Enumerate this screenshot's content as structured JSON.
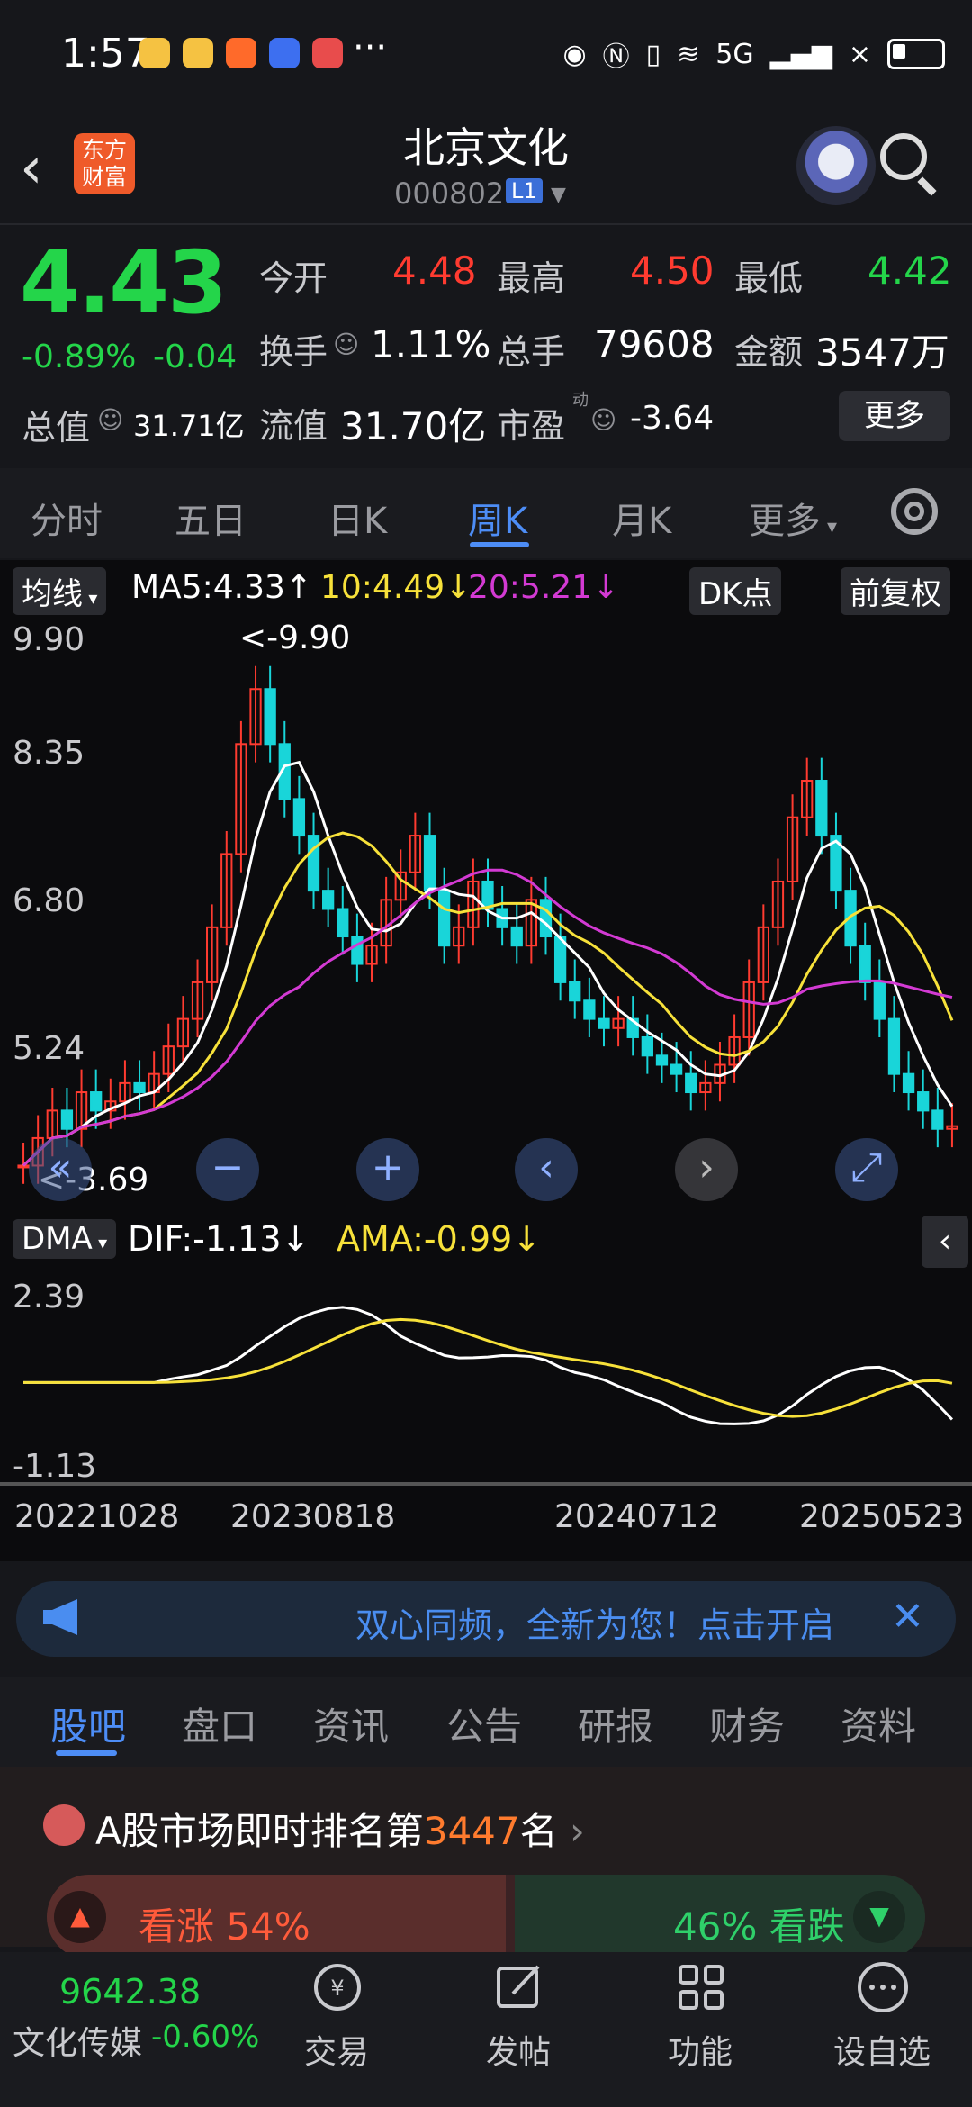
{
  "status": {
    "time": "1:57",
    "more": "···",
    "network": "5G",
    "x": "×"
  },
  "header": {
    "name": "北京文化",
    "code": "000802",
    "badge": "L1",
    "logo_text": "东方\n财富"
  },
  "quote": {
    "price": "4.43",
    "change_pct": "-0.89%",
    "change": "-0.04",
    "fields": [
      {
        "label": "今开",
        "value": "4.48",
        "color": "red"
      },
      {
        "label": "最高",
        "value": "4.50",
        "color": "red"
      },
      {
        "label": "最低",
        "value": "4.42",
        "color": "green"
      },
      {
        "label": "换手",
        "value": "1.11%",
        "color": "white"
      },
      {
        "label": "总手",
        "value": "79608",
        "color": "white"
      },
      {
        "label": "金额",
        "value": "3547万",
        "color": "white"
      },
      {
        "label": "总值",
        "value": "31.71亿",
        "color": "white"
      },
      {
        "label": "流值",
        "value": "31.70亿",
        "color": "white"
      },
      {
        "label": "市盈",
        "value": "-3.64",
        "color": "white"
      }
    ],
    "pe_sup": "动",
    "more_btn": "更多"
  },
  "ktabs": [
    "分时",
    "五日",
    "日K",
    "周K",
    "月K",
    "更多"
  ],
  "chart": {
    "ma_chip": "均线",
    "ma5": "MA5:4.33↑",
    "ma10": "10:4.49↓",
    "ma20": "20:5.21↓",
    "dk_chip": "DK点",
    "adj_chip": "前复权",
    "y_ticks": [
      "9.90",
      "8.35",
      "6.80",
      "5.24",
      "3.69"
    ],
    "max_label": "<-9.90",
    "min_label": "<-3.69",
    "dma_chip": "DMA",
    "dif": "DIF:-1.13↓",
    "ama": "AMA:-0.99↓",
    "dma_ticks": [
      "2.39",
      "-1.13"
    ],
    "dates": [
      "20221028",
      "20230818",
      "20240712",
      "20250523"
    ],
    "watermark": "东方财富",
    "colors": {
      "up": "#ff3b30",
      "down": "#19d5d9",
      "ma5": "#ffffff",
      "ma10": "#f7e13a",
      "ma20": "#d33ad3"
    }
  },
  "chart_data": {
    "type": "candlestick",
    "title": "北京文化 周K",
    "ylim": [
      3.69,
      9.9
    ],
    "ma": {
      "ma5_last": 4.33,
      "ma10_last": 4.49,
      "ma20_last": 5.21
    },
    "dma": {
      "dif_last": -1.13,
      "ama_last": -0.99,
      "range": [
        -1.13,
        2.39
      ]
    },
    "x_labels": [
      "20221028",
      "20230818",
      "20240712",
      "20250523"
    ]
  },
  "banner": {
    "text": "双心同频，全新为您！点击开启"
  },
  "btabs": [
    "股吧",
    "盘口",
    "资讯",
    "公告",
    "研报",
    "财务",
    "资料"
  ],
  "rank": {
    "prefix": "A股市场即时排名第",
    "num": "3447",
    "suffix": "名"
  },
  "vote": {
    "up": "看涨 54%",
    "down": "46% 看跌"
  },
  "bottom": {
    "index_value": "9642.38",
    "index_name": "文化传媒",
    "index_pct": "-0.60%",
    "items": [
      "交易",
      "发帖",
      "功能",
      "设自选"
    ]
  }
}
